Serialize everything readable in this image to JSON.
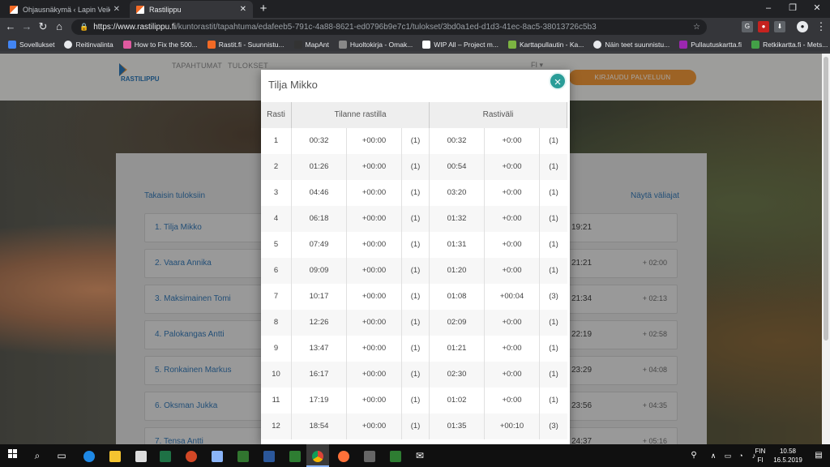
{
  "browser": {
    "tabs": [
      {
        "label": "Ohjausnäkymä ‹ Lapin Veikot su",
        "active": false
      },
      {
        "label": "Rastilippu",
        "active": true
      }
    ],
    "new_tab": "+",
    "window_controls": [
      "–",
      "❐",
      "✕"
    ],
    "url_host": "https://www.rastilippu.fi",
    "url_path": "/kuntorastit/tapahtuma/edafeeb5-791c-4a88-8621-ed0796b9e7c1/tulokset/3bd0a1ed-d1d3-41ec-8ac5-38013726c5b3",
    "bookmarks": [
      "Sovellukset",
      "Reitinvalinta",
      "How to Fix the 500...",
      "Rastit.fi - Suunnistu...",
      "MapAnt",
      "Huoltokirja - Omak...",
      "WIP All – Project m...",
      "Karttapullautin - Ka...",
      "Näin teet suunnistu...",
      "Pullautuskartta.fi",
      "Retkikartta.fi - Mets..."
    ]
  },
  "site": {
    "logo_text": "RASTILIPPU",
    "nav": [
      "TAPAHTUMAT",
      "TULOKSET"
    ],
    "lang": "FI ▾",
    "login": "KIRJAUDU PALVELUUN",
    "back_link": "Takaisin tuloksiin",
    "splits_link": "Näytä väliajat",
    "results": [
      {
        "name": "1. Tilja Mikko",
        "time": "19:21",
        "diff": ""
      },
      {
        "name": "2. Vaara Annika",
        "time": "21:21",
        "diff": "+ 02:00"
      },
      {
        "name": "3. Maksimainen Tomi",
        "time": "21:34",
        "diff": "+ 02:13"
      },
      {
        "name": "4. Palokangas Antti",
        "time": "22:19",
        "diff": "+ 02:58"
      },
      {
        "name": "5. Ronkainen Markus",
        "time": "23:29",
        "diff": "+ 04:08"
      },
      {
        "name": "6. Oksman Jukka",
        "time": "23:56",
        "diff": "+ 04:35"
      },
      {
        "name": "7. Tensa Antti",
        "time": "24:37",
        "diff": "+ 05:16"
      }
    ]
  },
  "modal": {
    "title": "Tilja Mikko",
    "close": "×",
    "headers": {
      "rasti": "Rasti",
      "tilanne": "Tilanne rastilla",
      "rastivali": "Rastiväli"
    },
    "rows": [
      [
        "1",
        "00:32",
        "+00:00",
        "(1)",
        "00:32",
        "+0:00",
        "(1)"
      ],
      [
        "2",
        "01:26",
        "+00:00",
        "(1)",
        "00:54",
        "+0:00",
        "(1)"
      ],
      [
        "3",
        "04:46",
        "+00:00",
        "(1)",
        "03:20",
        "+0:00",
        "(1)"
      ],
      [
        "4",
        "06:18",
        "+00:00",
        "(1)",
        "01:32",
        "+0:00",
        "(1)"
      ],
      [
        "5",
        "07:49",
        "+00:00",
        "(1)",
        "01:31",
        "+0:00",
        "(1)"
      ],
      [
        "6",
        "09:09",
        "+00:00",
        "(1)",
        "01:20",
        "+0:00",
        "(1)"
      ],
      [
        "7",
        "10:17",
        "+00:00",
        "(1)",
        "01:08",
        "+00:04",
        "(3)"
      ],
      [
        "8",
        "12:26",
        "+00:00",
        "(1)",
        "02:09",
        "+0:00",
        "(1)"
      ],
      [
        "9",
        "13:47",
        "+00:00",
        "(1)",
        "01:21",
        "+0:00",
        "(1)"
      ],
      [
        "10",
        "16:17",
        "+00:00",
        "(1)",
        "02:30",
        "+0:00",
        "(1)"
      ],
      [
        "11",
        "17:19",
        "+00:00",
        "(1)",
        "01:02",
        "+0:00",
        "(1)"
      ],
      [
        "12",
        "18:54",
        "+00:00",
        "(1)",
        "01:35",
        "+00:10",
        "(3)"
      ]
    ]
  },
  "taskbar": {
    "lang": "FIN",
    "lang_sub": "FI",
    "time": "10.58",
    "date": "16.5.2019"
  },
  "colors": {
    "accent": "#2a9d98",
    "login": "#f2993a",
    "link": "#3b84c6"
  }
}
